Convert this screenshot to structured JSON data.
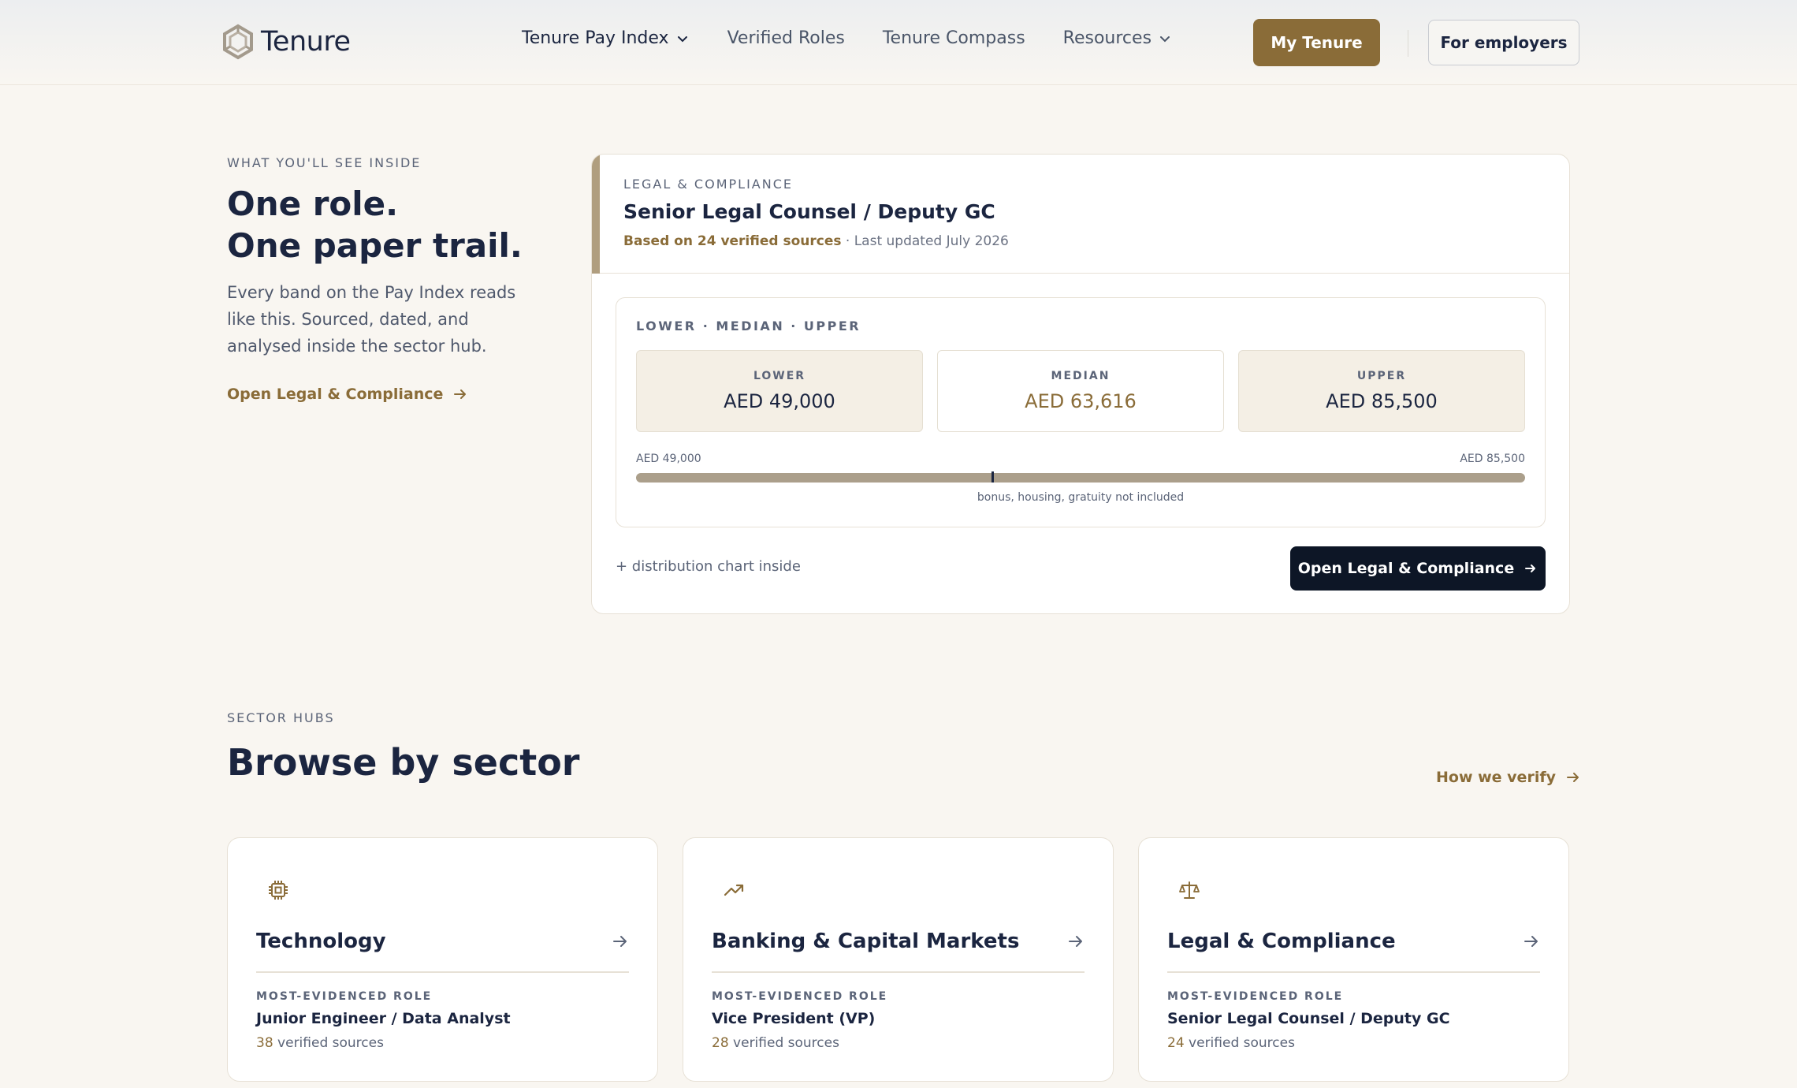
{
  "brand": {
    "name": "Tenure"
  },
  "nav": {
    "items": [
      {
        "label": "Tenure Pay Index",
        "has_dropdown": true
      },
      {
        "label": "Verified Roles",
        "has_dropdown": false
      },
      {
        "label": "Tenure Compass",
        "has_dropdown": false
      },
      {
        "label": "Resources",
        "has_dropdown": true
      }
    ],
    "my_tenure_label": "My Tenure",
    "employers_label": "For employers"
  },
  "intro": {
    "eyebrow": "WHAT YOU'LL SEE INSIDE",
    "title_line1": "One role.",
    "title_line2": "One paper trail.",
    "body": "Every band on the Pay Index reads like this. Sourced, dated, and analysed inside the sector hub.",
    "link_label": "Open Legal & Compliance"
  },
  "role_card": {
    "sector": "LEGAL & COMPLIANCE",
    "title": "Senior Legal Counsel / Deputy GC",
    "sources_label": "Based on 24 verified sources",
    "updated_label": "· Last updated July 2026",
    "band_label": "LOWER · MEDIAN · UPPER",
    "stats": [
      {
        "label": "LOWER",
        "value": "AED 49,000"
      },
      {
        "label": "MEDIAN",
        "value": "AED 63,616"
      },
      {
        "label": "UPPER",
        "value": "AED 85,500"
      }
    ],
    "range": {
      "min_label": "AED 49,000",
      "max_label": "AED 85,500",
      "min": 49000,
      "max": 85500,
      "median": 63616
    },
    "range_note": "bonus, housing, gratuity not included",
    "distribution_note": "+ distribution chart inside",
    "cta_label": "Open Legal & Compliance"
  },
  "sector_hubs": {
    "eyebrow": "SECTOR HUBS",
    "title": "Browse by sector",
    "verify_link": "How we verify",
    "cards": [
      {
        "icon": "chip-icon",
        "name": "Technology",
        "eyebrow": "MOST-EVIDENCED ROLE",
        "role": "Junior Engineer / Data Analyst",
        "count": "38",
        "sources_suffix": " verified sources"
      },
      {
        "icon": "trending-up-icon",
        "name": "Banking & Capital Markets",
        "eyebrow": "MOST-EVIDENCED ROLE",
        "role": "Vice President (VP)",
        "count": "28",
        "sources_suffix": " verified sources"
      },
      {
        "icon": "scales-icon",
        "name": "Legal & Compliance",
        "eyebrow": "MOST-EVIDENCED ROLE",
        "role": "Senior Legal Counsel / Deputy GC",
        "count": "24",
        "sources_suffix": " verified sources"
      }
    ]
  },
  "colors": {
    "accent_gold": "#8a6c38",
    "navy": "#1b2540",
    "background": "#f9f6f1",
    "cta_dark": "#0d1626"
  }
}
